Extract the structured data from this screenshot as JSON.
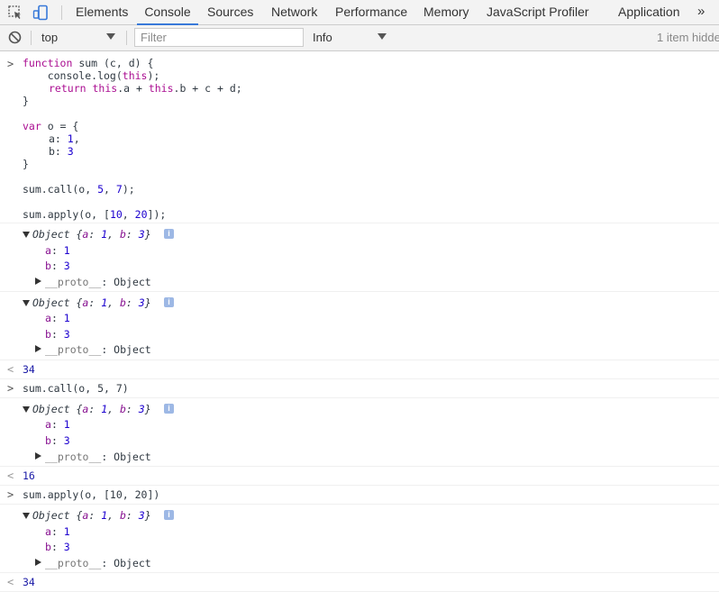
{
  "tabs": [
    {
      "label": "Elements",
      "active": false
    },
    {
      "label": "Console",
      "active": true
    },
    {
      "label": "Sources",
      "active": false
    },
    {
      "label": "Network",
      "active": false
    },
    {
      "label": "Performance",
      "active": false
    },
    {
      "label": "Memory",
      "active": false
    },
    {
      "label": "JavaScript Profiler",
      "active": false
    },
    {
      "label": "Application",
      "active": false
    }
  ],
  "more_tabs_glyph": "»",
  "toolbar": {
    "context": "top",
    "filter_placeholder": "Filter",
    "level": "Info",
    "hidden_note": "1 item hidde"
  },
  "code": {
    "l1a": "function",
    "l1b": " sum (c, d) {",
    "l2": "    console.log(",
    "l2kw": "this",
    "l2c": ");",
    "l3kw": "return",
    "l3kw2": "this",
    "l3b": ".a + ",
    "l3kw3": "this",
    "l3c": ".b + c + d;",
    "l4": "}",
    "l6kw": "var",
    "l6b": " o = {",
    "l7a": "a: ",
    "l7n": "1",
    "l7c": ",",
    "l8a": "b: ",
    "l8n": "3",
    "l9": "}",
    "l11a": "sum.call(o, ",
    "l11n1": "5",
    "l11b": ", ",
    "l11n2": "7",
    "l11c": ");",
    "l13a": "sum.apply(o, [",
    "l13n1": "10",
    "l13b": ", ",
    "l13n2": "20",
    "l13c": "]);"
  },
  "object": {
    "head": "Object {",
    "key_a": "a",
    "val_a": "1",
    "key_b": "b",
    "val_b": "3",
    "close": "}",
    "sep": ": ",
    "comma": ", ",
    "proto_key": "__proto__",
    "proto_val": "Object",
    "info": "i"
  },
  "results": [
    "34",
    "16",
    "34"
  ],
  "commands": {
    "call": "sum.call(o, 5, 7)",
    "apply": "sum.apply(o, [10, 20])"
  },
  "prompt_glyph": ">",
  "result_glyph": "<"
}
